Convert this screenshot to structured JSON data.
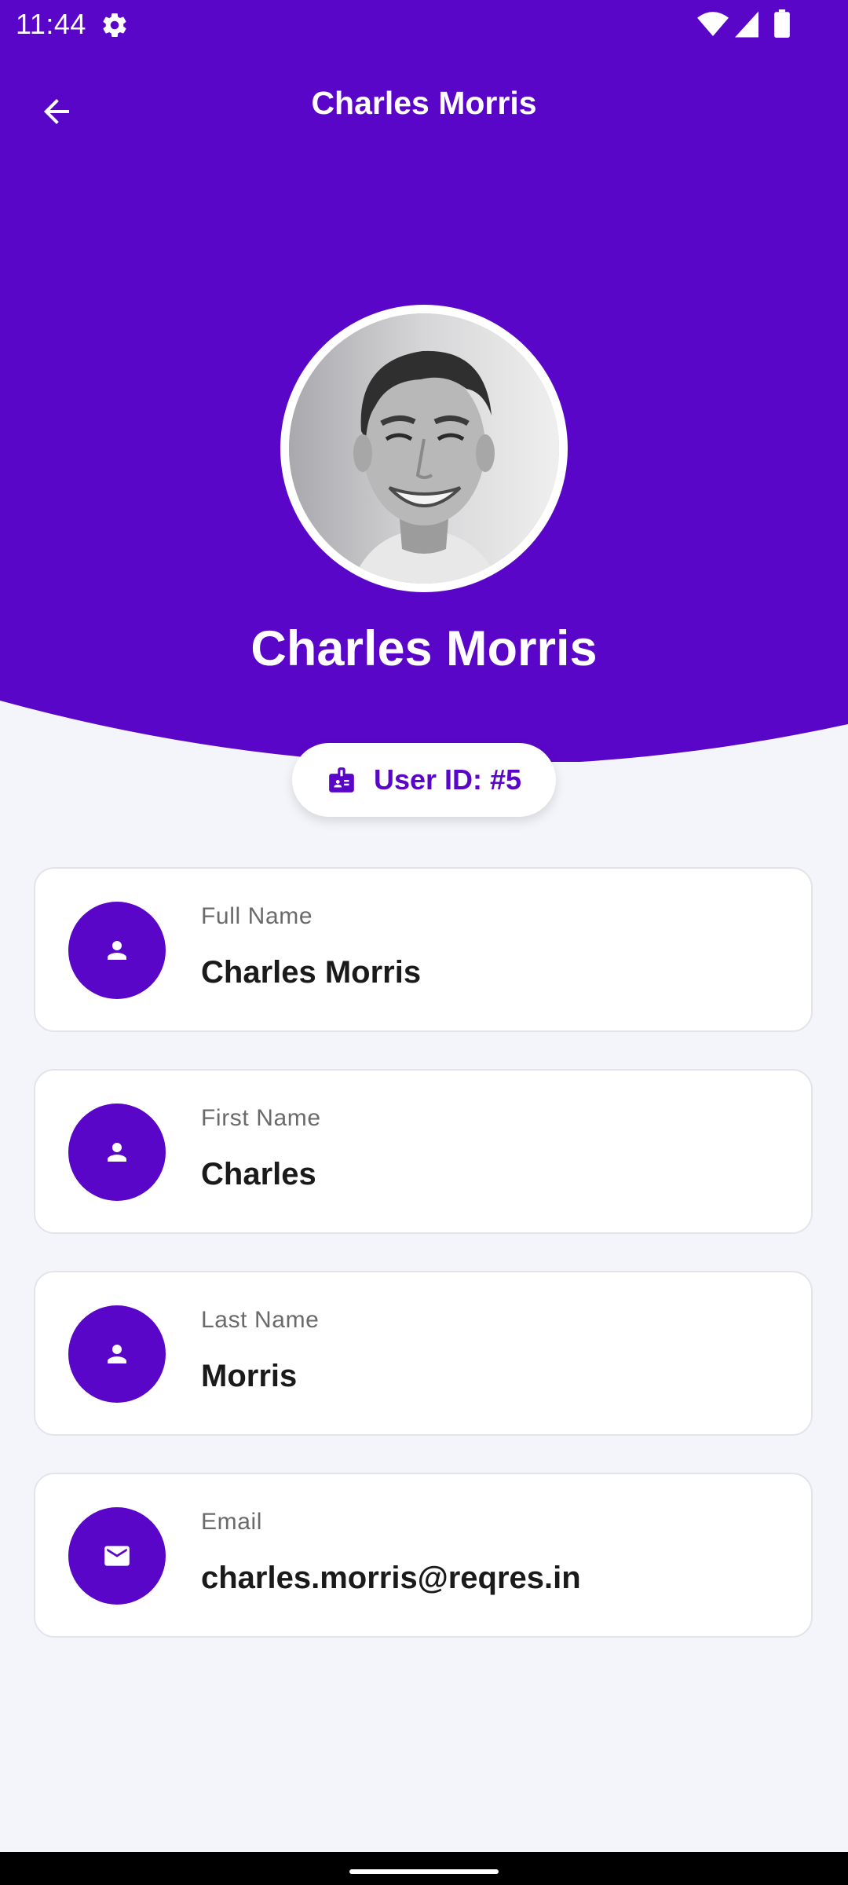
{
  "status_bar": {
    "time": "11:44",
    "icons": [
      "gear-icon",
      "wifi-icon",
      "signal-icon",
      "battery-icon"
    ]
  },
  "app_bar": {
    "title": "Charles Morris",
    "back_icon": "arrow-left-icon"
  },
  "profile": {
    "name": "Charles Morris",
    "avatar": "profile-photo",
    "user_id_label": "User ID: #5",
    "user_id_icon": "badge-icon"
  },
  "fields": [
    {
      "label": "Full Name",
      "value": "Charles Morris",
      "icon": "person-icon"
    },
    {
      "label": "First Name",
      "value": "Charles",
      "icon": "person-icon"
    },
    {
      "label": "Last Name",
      "value": "Morris",
      "icon": "person-icon"
    },
    {
      "label": "Email",
      "value": "charles.morris@reqres.in",
      "icon": "mail-icon"
    }
  ],
  "colors": {
    "primary": "#5a06c8",
    "background": "#f4f5fa",
    "card": "#ffffff",
    "text": "#1a1a1a",
    "label": "#6a6a6a"
  }
}
